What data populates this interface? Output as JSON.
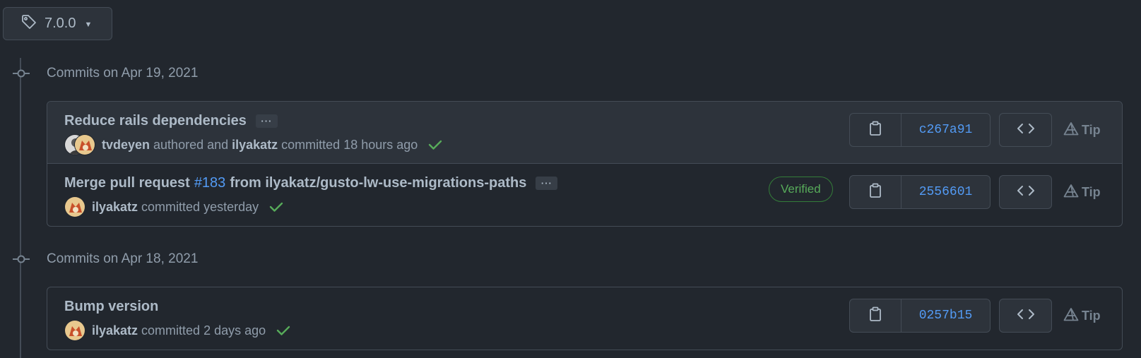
{
  "tag_selector": {
    "label": "7.0.0",
    "icon": "tag-icon"
  },
  "groups": [
    {
      "heading": "Commits on Apr 19, 2021",
      "commits": [
        {
          "title": "Reduce rails dependencies",
          "author1": "tvdeyen",
          "authored_text": "authored and",
          "author2": "ilyakatz",
          "committed_text": "committed 18 hours ago",
          "sha": "c267a91",
          "tip": "Tip"
        },
        {
          "title_prefix": "Merge pull request",
          "pr_number": "#183",
          "title_suffix": "from ilyakatz/gusto-lw-use-migrations-paths",
          "author": "ilyakatz",
          "committed_text": "committed yesterday",
          "verified": "Verified",
          "sha": "2556601",
          "tip": "Tip"
        }
      ]
    },
    {
      "heading": "Commits on Apr 18, 2021",
      "commits": [
        {
          "title": "Bump version",
          "author": "ilyakatz",
          "committed_text": "committed 2 days ago",
          "sha": "0257b15",
          "tip": "Tip"
        }
      ]
    }
  ],
  "colors": {
    "background": "#22272e",
    "link": "#539bf5",
    "success": "#57ab5a",
    "border": "#444c56"
  }
}
